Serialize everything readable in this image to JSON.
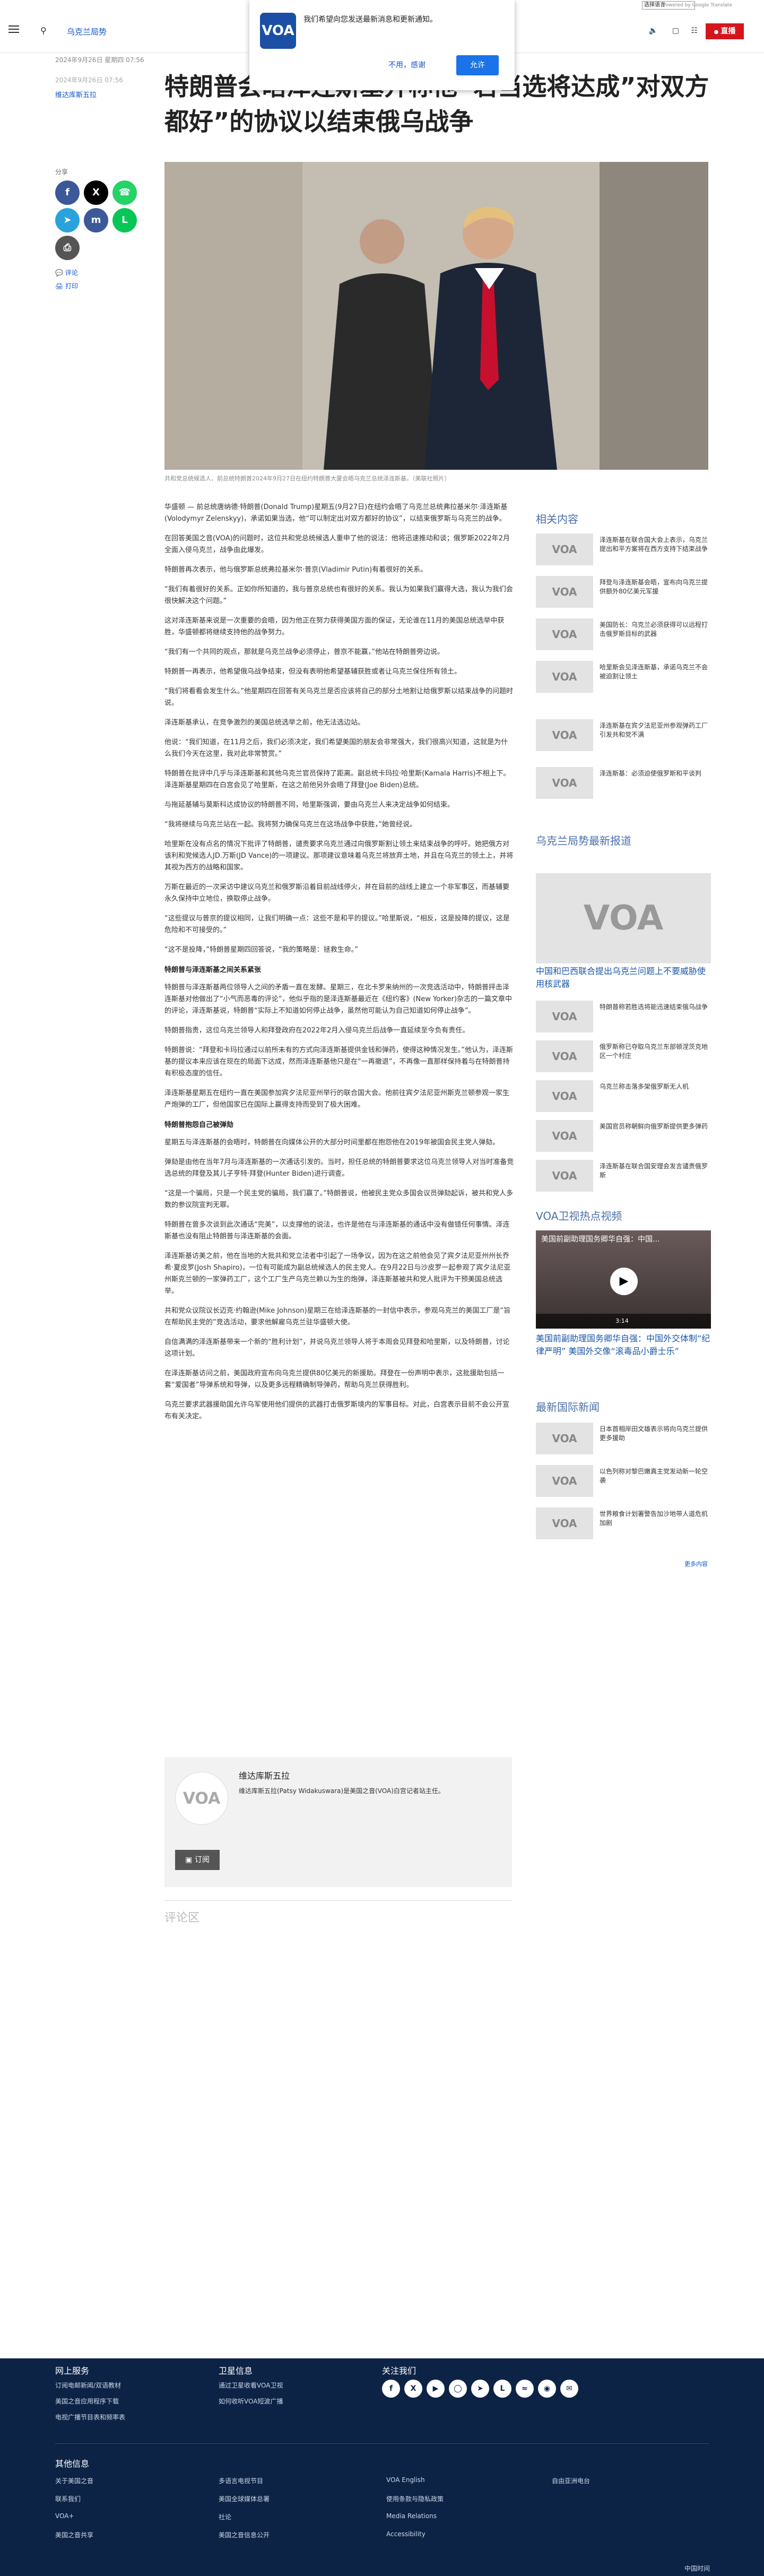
{
  "topbar": {
    "language": "选择语言",
    "powered_by": "Powered by Google Translate"
  },
  "header": {
    "section": "乌克兰局势",
    "live": "直播"
  },
  "notification": {
    "text": "我们希望向您发送最新消息和更新通知。",
    "no": "不用，感谢",
    "yes": "允许"
  },
  "article": {
    "date_top": "2024年9月26日 星期四 07:56",
    "date_updated": "2024年9月26日 07:56",
    "byline": "维达库斯五拉",
    "headline": "特朗普会晤泽连斯基并称他“若当选将达成”对双方都好”的协议以结束俄乌战争",
    "caption": "共和党总统候选人、前总统特朗普2024年9月27日在纽约特朗普大厦会晤乌克兰总统泽连斯基。（美联社照片）",
    "paragraphs": [
      "华盛顿 — 前总统唐纳德·特朗普(Donald Trump)星期五(9月27日)在纽约会晤了乌克兰总统弗拉基米尔·泽连斯基(Volodymyr Zelenskyy)，承诺如果当选，他“可以制定出对双方都好的协议”，以结束俄罗斯与乌克兰的战争。",
      "在回答美国之音(VOA)的问题时，这位共和党总统候选人重申了他的说法：他将迅速推动和谈；俄罗斯2022年2月全面入侵乌克兰，战争由此爆发。",
      "特朗普再次表示，他与俄罗斯总统弗拉基米尔·普京(Vladimir Putin)有着很好的关系。",
      "“我们有着很好的关系。正如你所知道的，我与普京总统也有很好的关系。我认为如果我们赢得大选，我认为我们会很快解决这个问题。”",
      "这对泽连斯基来说是一次重要的会晤，因为他正在努力获得美国方面的保证，无论谁在11月的美国总统选举中获胜，华盛顿都将继续支持他的战争努力。",
      "“我们有一个共同的观点，那就是乌克兰战争必须停止，普京不能赢，”他站在特朗普旁边说。",
      "特朗普一再表示，他希望俄乌战争结束，但没有表明他希望基辅获胜或者让乌克兰保住所有领土。",
      "“我们将看看会发生什么。”他星期四在回答有关乌克兰是否应该将自己的部分土地割让给俄罗斯以结束战争的问题时说。",
      "泽连斯基承认，在竞争激烈的美国总统选举之前，他无法选边站。",
      "他说：“我们知道，在11月之后，我们必须决定，我们希望美国的朋友会非常强大，我们很高兴知道，这就是为什么我们今天在这里，我对此非常赞赏。”",
      "特朗普在批评中几乎与泽连斯基和其他乌克兰官员保持了距离。副总统卡玛拉·哈里斯(Kamala Harris)不相上下。泽连斯基星期四在白宫会见了哈里斯，在这之前他另外会晤了拜登(Joe Biden)总统。",
      "与拖延基辅与莫斯科达成协议的特朗普不同，哈里斯强调，要由乌克兰人来决定战争如何结束。",
      "“我将继续与乌克兰站在一起。我将努力确保乌克兰在这场战争中获胜，”她曾经说。",
      "哈里斯在没有点名的情况下批评了特朗普，谴责要求乌克兰通过向俄罗斯割让领土来结束战争的呼吁。她把俄方对该利和党候选人JD.万斯(JD Vance)的一项建议。那项建议意味着乌克兰将放弃土地，并且在乌克兰的领土上，并将其视为西方的战略和国家。",
      "万斯在最近的一次采访中建议乌克兰和俄罗斯沿着目前战线停火，并在目前的战线上建立一个非军事区，而基辅要永久保持中立地位，换取停止战争。",
      "“这些提议与普京的提议相同，让我们明确一点：这些不是和平的提议。”哈里斯说，“相反，这是投降的提议，这是危险和不可接受的。”",
      "“这不是投降，”特朗普星期四回答说，“我的策略是：拯救生命。”",
      "特朗普与泽连斯基之间关系紧张",
      "特朗普与泽连斯基两位领导人之间的矛盾一直在发酵。星期三，在北卡罗来纳州的一次竞选活动中，特朗普抨击泽连斯基对他做出了“小气而恶毒的评论”，他似乎指的是泽连斯基最近在《纽约客》(New Yorker)杂志的一篇文章中的评论，泽连斯基说，特朗普“实际上不知道如何停止战争，虽然他可能认为自己知道如何停止战争”。",
      "特朗普指责，这位乌克兰领导人和拜登政府在2022年2月入侵乌克兰后战争一直延续至今负有责任。",
      "特朗普说：“拜登和卡玛拉通过以前所未有的方式向泽连斯基提供金钱和弹药，使得这种情况发生。”他认为，泽连斯基的提议本来应该在现在的局面下达成，然而泽连斯基他只是在“一再撤退”，不再像一直那样保持着与在特朗普持有积极态度的信任。",
      "泽连斯基星期五在纽约一直在美国参加宾夕法尼亚州举行的联合国大会。他前往宾夕法尼亚州斯克兰顿参观一家生产炮弹的工厂，但他国家已在国际上赢得支持而受到了极大困难。",
      "特朗普抱怨自己被弹劾",
      "星期五与泽连斯基的会晤时，特朗普在向媒体公开的大部分时间里都在抱怨他在2019年被国会民主党人弹劾。",
      "弹劾是由他在当年7月与泽连斯基的一次通话引发的。当时，担任总统的特朗普要求这位乌克兰领导人对当时准备竞选总统的拜登及其儿子亨特·拜登(Hunter Biden)进行调查。",
      "“这是一个骗局，只是一个民主党的骗局，我们赢了。”特朗普说，他被民主党众多国会议员弹劾起诉，被共和党人多数的参议院宣判无罪。",
      "特朗普在曾多次谈到此次通话“完美”，以支撑他的说法，也许是他在与泽连斯基的通话中没有做错任何事情。泽连斯基也没有阻止特朗普与泽连斯基的会面。",
      "泽连斯基访美之前，他在当地的大批共和党立法者中引起了一场争议，因为在这之前他会见了宾夕法尼亚州州长乔希·夏皮罗(Josh Shapiro)，一位有可能成为副总统候选人的民主党人。在9月22日与沙皮罗一起参观了宾夕法尼亚州斯克兰顿的一家弹药工厂，这个工厂生产乌克兰赖以为生的炮弹，泽连斯基被共和党人批评为干预美国总统选举。",
      "共和党众议院议长迈克·约翰逊(Mike Johnson)星期三在给泽连斯基的一封信中表示，参观乌克兰的美国工厂是“旨在帮助民主党的”竞选活动，要求他解雇乌克兰驻华盛顿大使。",
      "自信满满的泽连斯基带来一个新的“胜利计划”，并说乌克兰领导人将于本周会见拜登和哈里斯，以及特朗普，讨论这项计划。",
      "在泽连斯基访问之前，美国政府宣布向乌克兰提供80亿美元的新援助。拜登在一份声明中表示，这批援助包括一套“爱国者”导弹系统和导弹，以及更多远程精确制导弹药，帮助乌克兰获得胜利。",
      "乌克兰要求武器援助国允许乌军使用他们提供的武器打击俄罗斯境内的军事目标。对此，白宫表示目前不会公开宣布有关决定。"
    ],
    "subheads": [
      "特朗普与泽连斯基之间关系紧张",
      "特朗普抱怨自己被弹劾"
    ]
  },
  "share": {
    "label": "分享",
    "comment": "评论",
    "print": "打印"
  },
  "author": {
    "name": "维达库斯五拉",
    "bio": "维达库斯五拉(Patsy Widakuswara)是美国之音(VOA)白宫记者站主任。",
    "subscribe": "订阅"
  },
  "comments": {
    "title": "评论区"
  },
  "sidebar": {
    "related_title": "相关内容",
    "related": [
      "泽连斯基在联合国大会上表示，乌克兰提出和平方案将在西方支持下结束战争",
      "拜登与泽连斯基会晤，宣布向乌克兰提供额外80亿美元军援",
      "美国防长：乌克兰必须获得可以远程打击俄罗斯目标的武器",
      "哈里斯会见泽连斯基，承诺乌克兰不会被迫割让领土",
      "泽连斯基在宾夕法尼亚州参观弹药工厂引发共和党不满",
      "泽连斯基：必须迫使俄罗斯和平谈判"
    ],
    "latest_title": "乌克兰局势最新报道",
    "latest_main": "中国和巴西联合提出乌克兰问题上不要威胁使用核武器",
    "latest": [
      "特朗普称若胜选将能迅速结束俄乌战争",
      "俄罗斯称已夺取乌克兰东部顿涅茨克地区一个村庄",
      "乌克兰称击落多架俄罗斯无人机",
      "美国官员称朝鲜向俄罗斯提供更多弹药",
      "泽连斯基在联合国安理会发言谴责俄罗斯"
    ],
    "video_title": "VOA卫视热点视频",
    "video_overlay": "美国前副助理国务卿华自强：中国...",
    "video_time": "3:14",
    "video_caption": "美国前副助理国务卿华自强：中国外交体制“纪律严明” 美国外交像“滚毒品小爵士乐”",
    "intl_title": "最新国际新闻",
    "intl": [
      "日本首相岸田文雄表示将向乌克兰提供更多援助",
      "以色列称对黎巴嫩真主党发动新一轮空袭",
      "世界粮食计划署警告加沙地带人道危机加剧"
    ],
    "more": "更多内容"
  },
  "footer": {
    "col1_title": "网上服务",
    "col1": [
      "订阅电邮新闻/双语教材",
      "美国之音应用程序下载",
      "电视广播节目表和频率表"
    ],
    "col2_title": "卫星信息",
    "col2": [
      "通过卫星收看VOA卫视",
      "如何收听VOA短波广播"
    ],
    "col3_title": "关注我们",
    "other_title": "其他信息",
    "links": [
      [
        "关于美国之音",
        "联系我们",
        "VOA+",
        "美国之音共享"
      ],
      [
        "多语言电视节目",
        "美国全球媒体总署",
        "社论",
        "美国之音信息公开"
      ],
      [
        "VOA English",
        "使用条款与隐私政策",
        "Media Relations",
        "Accessibility"
      ],
      [
        "自由亚洲电台"
      ]
    ],
    "copyright": "中国时间"
  }
}
